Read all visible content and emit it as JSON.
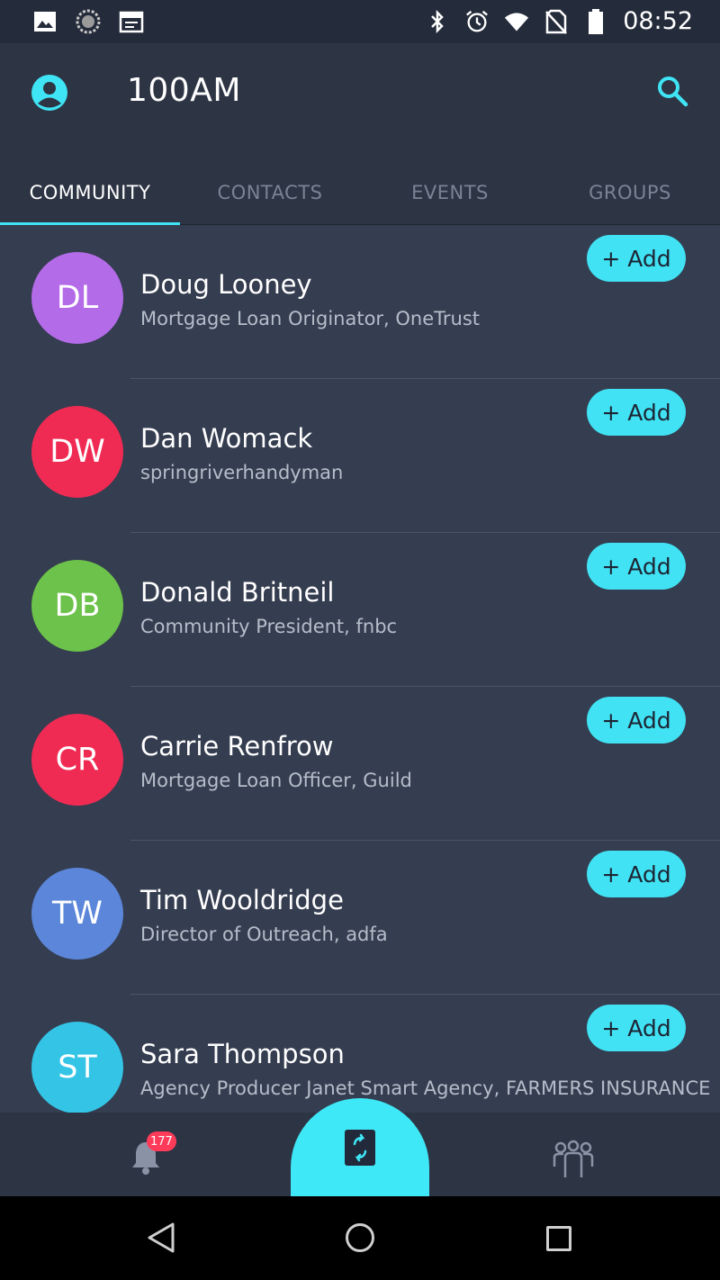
{
  "status_bar": {
    "time": "08:52",
    "left_icons": [
      "image-icon",
      "loading-icon",
      "calendar-icon"
    ],
    "right_icons": [
      "bluetooth-icon",
      "alarm-icon",
      "wifi-icon",
      "no-sim-icon",
      "battery-icon"
    ]
  },
  "app_bar": {
    "title": "100AM",
    "profile_icon": "account-circle-icon",
    "search_icon": "search-icon"
  },
  "tabs": [
    {
      "label": "COMMUNITY",
      "active": true
    },
    {
      "label": "CONTACTS",
      "active": false
    },
    {
      "label": "EVENTS",
      "active": false
    },
    {
      "label": "GROUPS",
      "active": false
    }
  ],
  "people": [
    {
      "initials": "DL",
      "name": "Doug Looney",
      "subtitle": "Mortgage Loan Originator, OneTrust",
      "color": "#b36be8",
      "action": "+ Add"
    },
    {
      "initials": "DW",
      "name": "Dan Womack",
      "subtitle": "springriverhandyman",
      "color": "#f02b53",
      "action": "+ Add"
    },
    {
      "initials": "DB",
      "name": "Donald Britneil",
      "subtitle": "Community President, fnbc",
      "color": "#6cc24a",
      "action": "+ Add"
    },
    {
      "initials": "CR",
      "name": "Carrie Renfrow",
      "subtitle": "Mortgage Loan Officer, Guild",
      "color": "#f02b53",
      "action": "+ Add"
    },
    {
      "initials": "TW",
      "name": "Tim Wooldridge",
      "subtitle": "Director of Outreach, adfa",
      "color": "#5b86d9",
      "action": "+ Add"
    },
    {
      "initials": "ST",
      "name": "Sara Thompson",
      "subtitle": "Agency Producer Janet Smart Agency, FARMERS INSURANCE",
      "color": "#33c4e6",
      "action": "+ Add"
    }
  ],
  "bottom_nav": {
    "notifications_badge": "177",
    "accent_color": "#3fe8f7"
  }
}
